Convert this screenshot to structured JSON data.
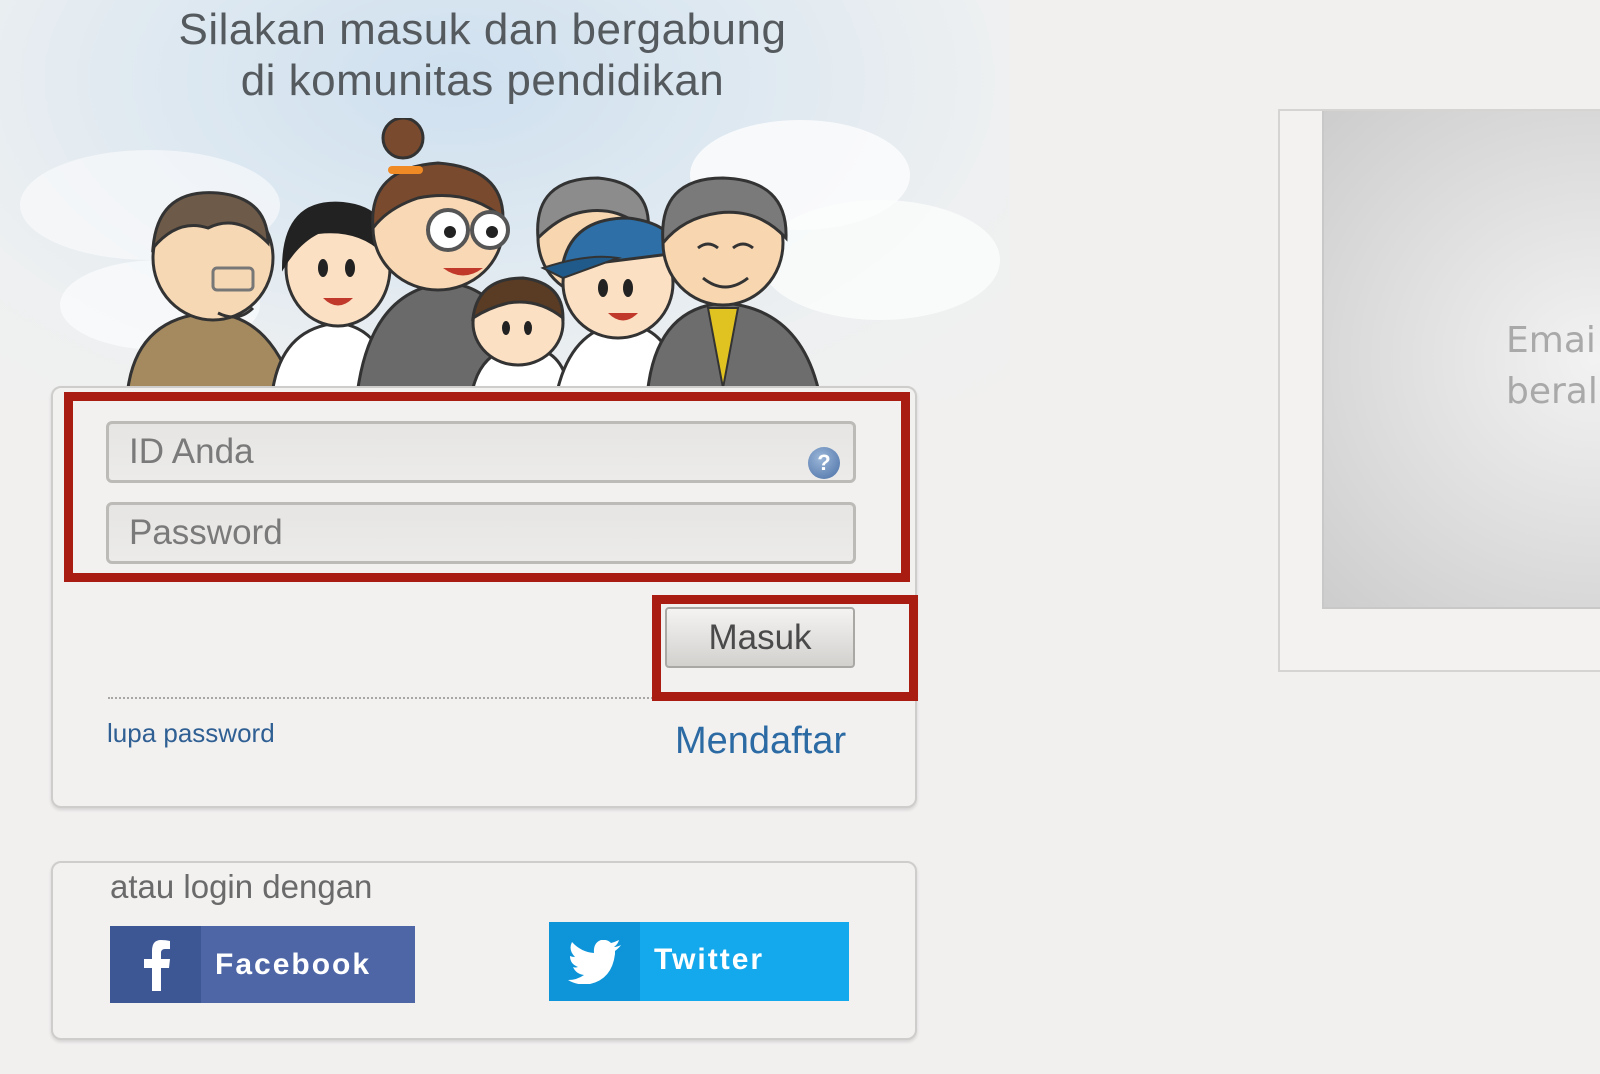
{
  "hero": {
    "tagline_line1": "Silakan masuk dan bergabung",
    "tagline_line2": "di komunitas pendidikan"
  },
  "login": {
    "id_placeholder": "ID Anda",
    "password_placeholder": "Password",
    "help_icon": "question-circle-icon",
    "submit_label": "Masuk",
    "forgot_label": "lupa password",
    "register_label": "Mendaftar"
  },
  "social": {
    "heading": "atau login dengan",
    "facebook_label": "Facebook",
    "twitter_label": "Twitter",
    "facebook_color": "#4e66a6",
    "twitter_color": "#14a8ec"
  },
  "side_panel": {
    "line1": "Emai",
    "line2": "beral"
  },
  "colors": {
    "highlight": "#a81c12",
    "link": "#2c6aa4"
  }
}
